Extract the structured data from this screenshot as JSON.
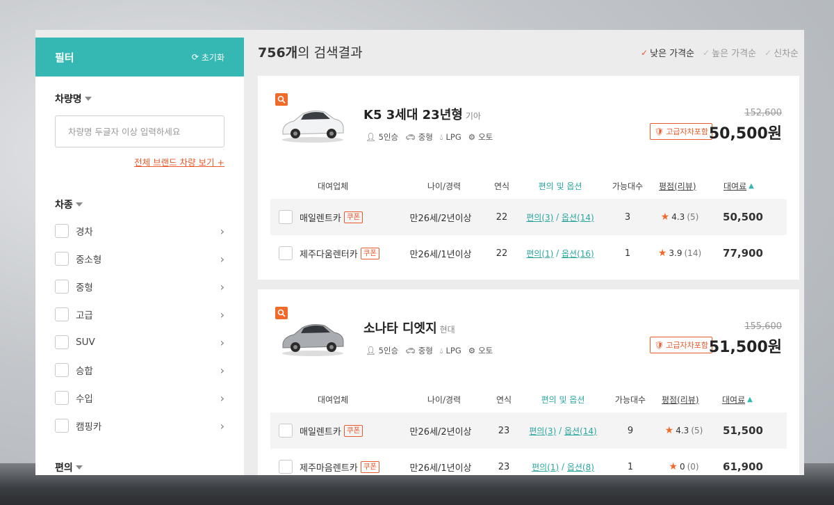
{
  "filter": {
    "title": "필터",
    "reset_label": "초기화",
    "car_name": {
      "title": "차량명",
      "placeholder": "차량명 두글자 이상 입력하세요",
      "all_brands_link": "전체 브랜드 차량 보기 +"
    },
    "car_type": {
      "title": "차종",
      "items": [
        "경차",
        "중소형",
        "중형",
        "고급",
        "SUV",
        "승합",
        "수입",
        "캠핑카"
      ]
    },
    "convenience_title": "편의"
  },
  "results": {
    "count": "756개",
    "count_suffix": "의 검색결과",
    "sort_options": [
      "낮은 가격순",
      "높은 가격순",
      "신차순"
    ],
    "active_sort": "낮은 가격순"
  },
  "table_headers": {
    "company": "대여업체",
    "age": "나이/경력",
    "year": "연식",
    "options": "편의 및 옵션",
    "avail": "가능대수",
    "rating": "평점(리뷰)",
    "fee": "대여료"
  },
  "cars": [
    {
      "name": "K5 3세대 23년형",
      "maker": "기아",
      "specs": {
        "seats": "5인승",
        "size": "중형",
        "fuel": "LPG",
        "trans": "오토"
      },
      "original_price": "152,600",
      "premium_badge": "고급자차포함",
      "price": "50,500원",
      "rows": [
        {
          "company": "매일렌트카",
          "coupon": "쿠폰",
          "age": "만26세/2년이상",
          "year": "22",
          "opt_a": "편의(3)",
          "opt_b": "옵션(14)",
          "avail": "3",
          "rating": "4.3",
          "reviews": "(5)",
          "fee": "50,500"
        },
        {
          "company": "제주다움렌터카",
          "coupon": "쿠폰",
          "age": "만26세/1년이상",
          "year": "22",
          "opt_a": "편의(1)",
          "opt_b": "옵션(16)",
          "avail": "1",
          "rating": "3.9",
          "reviews": "(14)",
          "fee": "77,900"
        }
      ]
    },
    {
      "name": "소나타 디엣지",
      "maker": "현대",
      "specs": {
        "seats": "5인승",
        "size": "중형",
        "fuel": "LPG",
        "trans": "오토"
      },
      "original_price": "155,600",
      "premium_badge": "고급자차포함",
      "price": "51,500원",
      "rows": [
        {
          "company": "매일렌트카",
          "coupon": "쿠폰",
          "age": "만26세/2년이상",
          "year": "23",
          "opt_a": "편의(3)",
          "opt_b": "옵션(14)",
          "avail": "9",
          "rating": "4.3",
          "reviews": "(5)",
          "fee": "51,500"
        },
        {
          "company": "제주마음렌트카",
          "coupon": "쿠폰",
          "age": "만26세/1년이상",
          "year": "23",
          "opt_a": "편의(1)",
          "opt_b": "옵션(8)",
          "avail": "1",
          "rating": "0",
          "reviews": "(0)",
          "fee": "61,900"
        }
      ]
    }
  ],
  "colors": {
    "teal": "#35b8b3",
    "orange": "#e8592b",
    "background": "#ececec"
  }
}
